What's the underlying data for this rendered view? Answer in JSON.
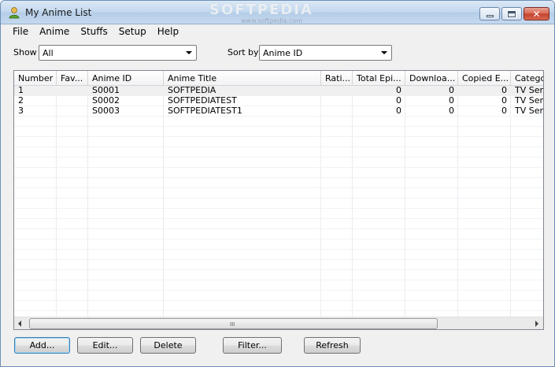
{
  "window": {
    "title": "My Anime List",
    "watermark": "SOFTPEDIA",
    "watermark_sub": "www.softpedia.com",
    "close_glyph": "✕"
  },
  "menu": [
    "File",
    "Anime",
    "Stuffs",
    "Setup",
    "Help"
  ],
  "filter": {
    "show_label": "Show",
    "show_value": "All",
    "sort_label": "Sort by",
    "sort_value": "Anime ID"
  },
  "table": {
    "columns": [
      "Number",
      "Fav...",
      "Anime ID",
      "Anime Title",
      "Rati...",
      "Total Epi...",
      "Downloa...",
      "Copied E...",
      "Catego"
    ],
    "rows": [
      [
        "1",
        "",
        "S0001",
        "SOFTPEDIA",
        "",
        "0",
        "0",
        "0",
        "TV Seri"
      ],
      [
        "2",
        "",
        "S0002",
        "SOFTPEDIATEST",
        "",
        "0",
        "0",
        "0",
        "TV Seri"
      ],
      [
        "3",
        "",
        "S0003",
        "SOFTPEDIATEST1",
        "",
        "0",
        "0",
        "0",
        "TV Seri"
      ]
    ]
  },
  "scrollbar": {
    "grip": "III"
  },
  "buttons": {
    "add": "Add...",
    "edit": "Edit...",
    "delete": "Delete",
    "filter": "Filter...",
    "refresh": "Refresh"
  },
  "colors": {
    "selected_row": "#f0f0f0",
    "window_bg": "#f0f0f0",
    "close_red": "#c4412a"
  }
}
